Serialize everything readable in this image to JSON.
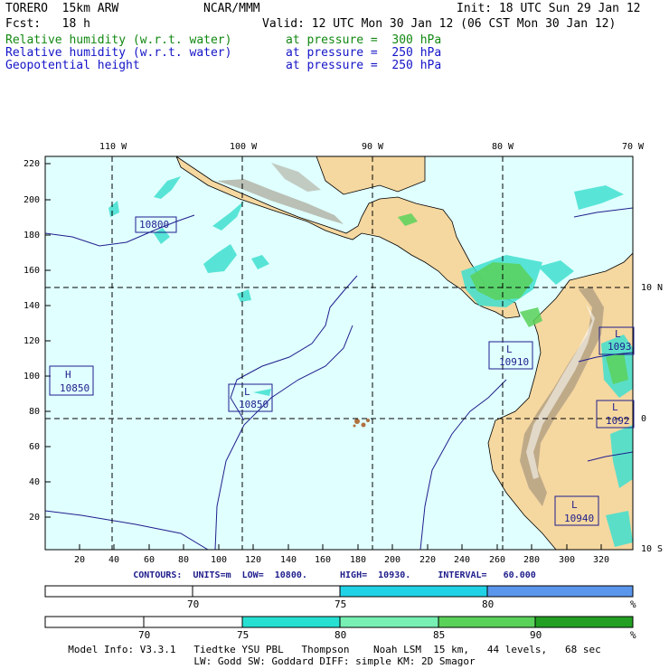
{
  "header": {
    "model": "TORERO  15km ARW",
    "org": "NCAR/MMM",
    "init": "Init: 18 UTC Sun 29 Jan 12",
    "fcst": "Fcst:   18 h",
    "valid": "Valid: 12 UTC Mon 30 Jan 12 (06 CST Mon 30 Jan 12)",
    "fields": [
      {
        "name": "Relative humidity (w.r.t. water)",
        "level": "at pressure =  300 hPa",
        "color": "#118811"
      },
      {
        "name": "Relative humidity (w.r.t. water)",
        "level": "at pressure =  250 hPa",
        "color": "#1414c8"
      },
      {
        "name": "Geopotential height",
        "level": "at pressure =  250 hPa",
        "color": "#1414c8"
      }
    ]
  },
  "map": {
    "lon_labels": [
      "110 W",
      "100 W",
      "90 W",
      "80 W",
      "70 W"
    ],
    "lat_labels": [
      "10 N",
      "0",
      "10 S"
    ],
    "y_grid_labels": [
      "220",
      "200",
      "180",
      "160",
      "140",
      "120",
      "100",
      "80",
      "60",
      "40",
      "20"
    ],
    "x_grid_labels": [
      "20",
      "40",
      "60",
      "80",
      "100",
      "120",
      "140",
      "160",
      "180",
      "200",
      "220",
      "240",
      "260",
      "280",
      "300",
      "320"
    ],
    "colors": {
      "ocean": "#e0ffff",
      "land": "#f5d7a0",
      "terrain": "#9b8c78",
      "rh_light": "#40e0d0",
      "rh_green": "#5ad25a"
    },
    "pressure_centers": [
      {
        "letter": "H",
        "value": "10850"
      },
      {
        "letter": "",
        "value": "10800"
      },
      {
        "letter": "L",
        "value": "10850"
      },
      {
        "letter": "L",
        "value": "10910"
      },
      {
        "letter": "L",
        "value": "1093"
      },
      {
        "letter": "L",
        "value": "1092"
      },
      {
        "letter": "L",
        "value": "10940"
      }
    ]
  },
  "contours": "CONTOURS:  UNITS=m  LOW=  10800.      HIGH=  10930.     INTERVAL=   60.000",
  "colorbar_250": {
    "ticks": [
      "70",
      "75",
      "80"
    ],
    "unit": "%",
    "colors": [
      "#ffffff",
      "#ffffff",
      "#20d2e6",
      "#5a96eb"
    ]
  },
  "colorbar_300": {
    "ticks": [
      "70",
      "75",
      "80",
      "85",
      "90"
    ],
    "unit": "%",
    "colors": [
      "#ffffff",
      "#ffffff",
      "#28e0d2",
      "#78f0b4",
      "#5ad25a",
      "#23a023"
    ]
  },
  "footer": {
    "line1": "Model Info: V3.3.1   Tiedtke YSU PBL   Thompson    Noah LSM  15 km,   44 levels,   68 sec",
    "line2": "LW: Godd SW: Goddard DIFF: simple KM: 2D Smagor"
  }
}
